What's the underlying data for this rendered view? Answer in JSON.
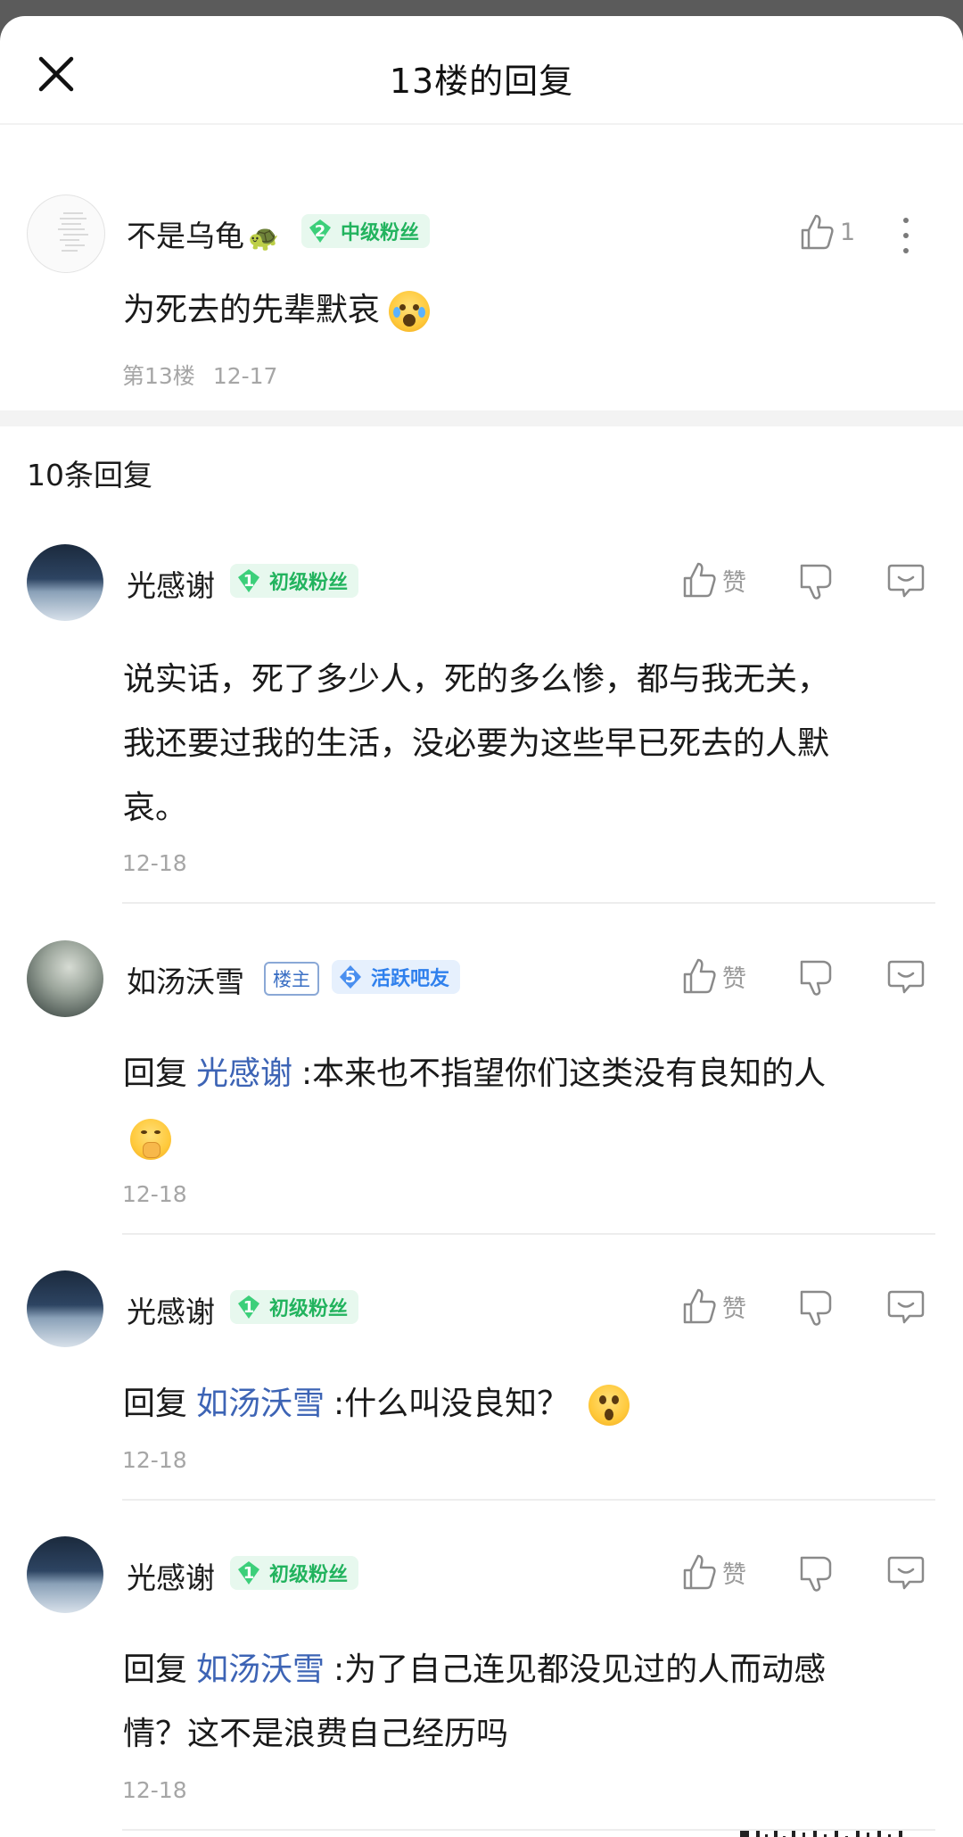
{
  "header": {
    "title": "13楼的回复",
    "close_icon": "close-icon"
  },
  "floor": {
    "username": "不是乌龟",
    "user_emoji": "🐢",
    "badge_level": "2",
    "badge_text": "中级粉丝",
    "like_count": "1",
    "content": "为死去的先辈默哀",
    "floor_label": "第13楼",
    "date": "12-17"
  },
  "replies_count": "10条回复",
  "replies": [
    {
      "username": "光感谢",
      "badge_level": "1",
      "badge_text": "初级粉丝",
      "like_label": "赞",
      "reply_prefix": "",
      "mention": "",
      "content_lines": [
        "说实话，死了多少人，死的多么惨，都与我无关，",
        "我还要过我的生活，没必要为这些早已死去的人默",
        "哀。"
      ],
      "date": "12-18"
    },
    {
      "username": "如汤沃雪",
      "owner_tag": "楼主",
      "badge_level": "5",
      "badge_text": "活跃吧友",
      "like_label": "赞",
      "reply_prefix": "回复",
      "mention": "光感谢",
      "content": ":本来也不指望你们这类没有良知的人",
      "date": "12-18"
    },
    {
      "username": "光感谢",
      "badge_level": "1",
      "badge_text": "初级粉丝",
      "like_label": "赞",
      "reply_prefix": "回复",
      "mention": "如汤沃雪",
      "content": ":什么叫没良知？",
      "date": "12-18"
    },
    {
      "username": "光感谢",
      "badge_level": "1",
      "badge_text": "初级粉丝",
      "like_label": "赞",
      "reply_prefix": "回复",
      "mention": "如汤沃雪",
      "content": ":为了自己连见都没见过的人而动感",
      "content_line2": "情？这不是浪费自己经历吗",
      "date": "12-18"
    }
  ],
  "colors": {
    "accent_green": "#22b35e",
    "mention_blue": "#3d64b5",
    "meta_gray": "#a6a6a6"
  }
}
